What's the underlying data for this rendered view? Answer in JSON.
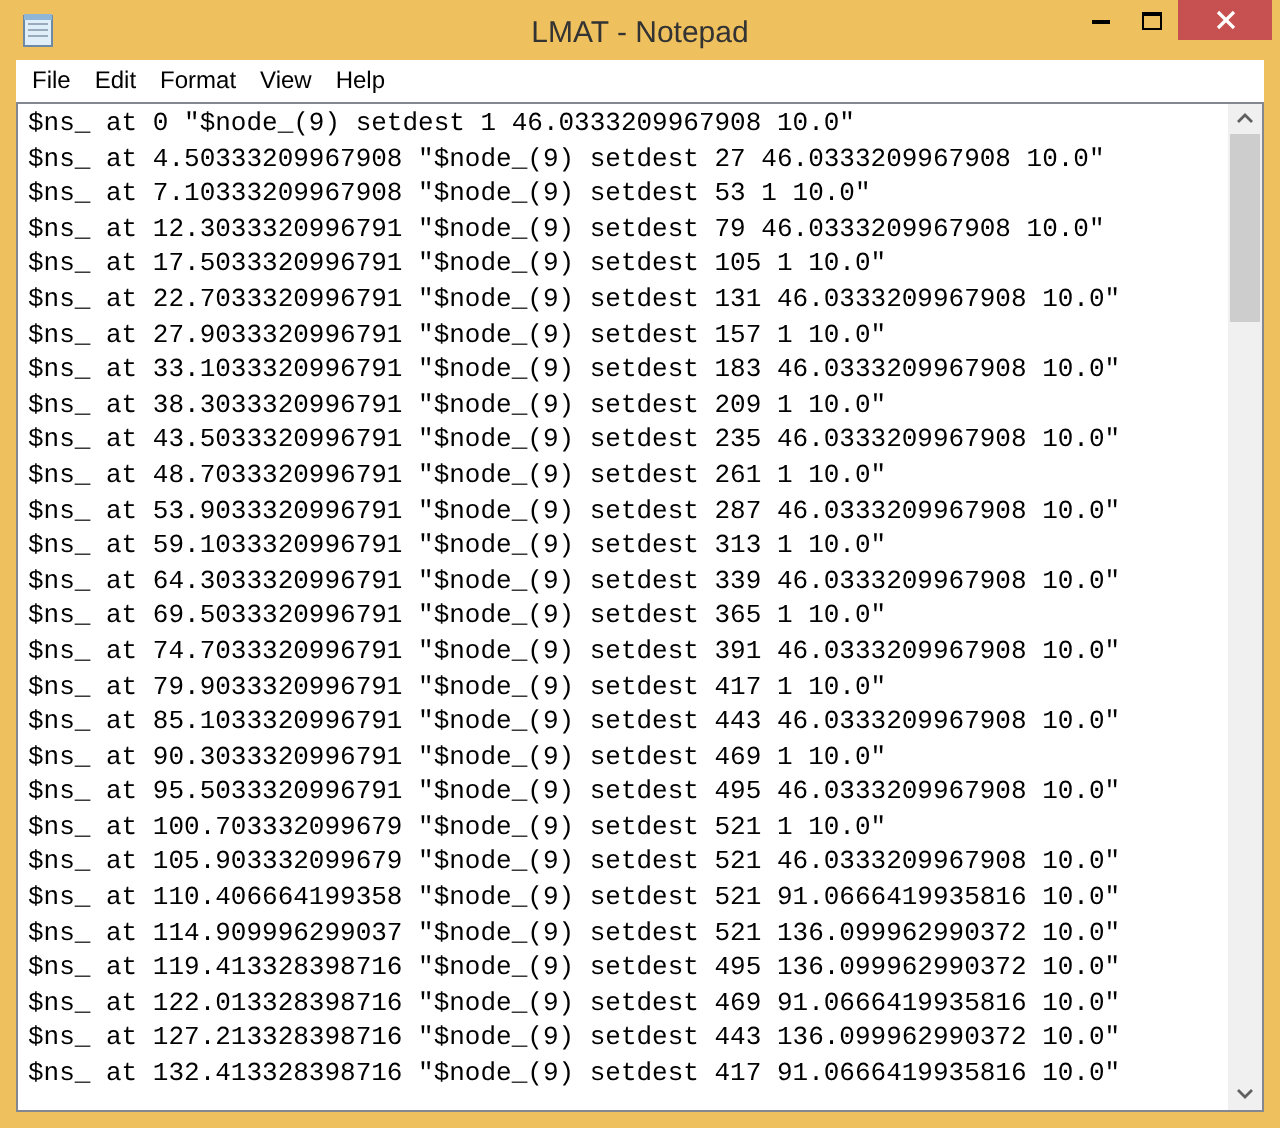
{
  "window": {
    "title": "LMAT - Notepad"
  },
  "menu": [
    {
      "label": "File"
    },
    {
      "label": "Edit"
    },
    {
      "label": "Format"
    },
    {
      "label": "View"
    },
    {
      "label": "Help"
    }
  ],
  "lines": [
    "$ns_ at 0 \"$node_(9) setdest 1 46.0333209967908 10.0\"",
    "$ns_ at 4.50333209967908 \"$node_(9) setdest 27 46.0333209967908 10.0\"",
    "$ns_ at 7.10333209967908 \"$node_(9) setdest 53 1 10.0\"",
    "$ns_ at 12.3033320996791 \"$node_(9) setdest 79 46.0333209967908 10.0\"",
    "$ns_ at 17.5033320996791 \"$node_(9) setdest 105 1 10.0\"",
    "$ns_ at 22.7033320996791 \"$node_(9) setdest 131 46.0333209967908 10.0\"",
    "$ns_ at 27.9033320996791 \"$node_(9) setdest 157 1 10.0\"",
    "$ns_ at 33.1033320996791 \"$node_(9) setdest 183 46.0333209967908 10.0\"",
    "$ns_ at 38.3033320996791 \"$node_(9) setdest 209 1 10.0\"",
    "$ns_ at 43.5033320996791 \"$node_(9) setdest 235 46.0333209967908 10.0\"",
    "$ns_ at 48.7033320996791 \"$node_(9) setdest 261 1 10.0\"",
    "$ns_ at 53.9033320996791 \"$node_(9) setdest 287 46.0333209967908 10.0\"",
    "$ns_ at 59.1033320996791 \"$node_(9) setdest 313 1 10.0\"",
    "$ns_ at 64.3033320996791 \"$node_(9) setdest 339 46.0333209967908 10.0\"",
    "$ns_ at 69.5033320996791 \"$node_(9) setdest 365 1 10.0\"",
    "$ns_ at 74.7033320996791 \"$node_(9) setdest 391 46.0333209967908 10.0\"",
    "$ns_ at 79.9033320996791 \"$node_(9) setdest 417 1 10.0\"",
    "$ns_ at 85.1033320996791 \"$node_(9) setdest 443 46.0333209967908 10.0\"",
    "$ns_ at 90.3033320996791 \"$node_(9) setdest 469 1 10.0\"",
    "$ns_ at 95.5033320996791 \"$node_(9) setdest 495 46.0333209967908 10.0\"",
    "$ns_ at 100.703332099679 \"$node_(9) setdest 521 1 10.0\"",
    "$ns_ at 105.903332099679 \"$node_(9) setdest 521 46.0333209967908 10.0\"",
    "$ns_ at 110.406664199358 \"$node_(9) setdest 521 91.0666419935816 10.0\"",
    "$ns_ at 114.909996299037 \"$node_(9) setdest 521 136.099962990372 10.0\"",
    "$ns_ at 119.413328398716 \"$node_(9) setdest 495 136.099962990372 10.0\"",
    "$ns_ at 122.013328398716 \"$node_(9) setdest 469 91.0666419935816 10.0\"",
    "$ns_ at 127.213328398716 \"$node_(9) setdest 443 136.099962990372 10.0\"",
    "$ns_ at 132.413328398716 \"$node_(9) setdest 417 91.0666419935816 10.0\""
  ]
}
